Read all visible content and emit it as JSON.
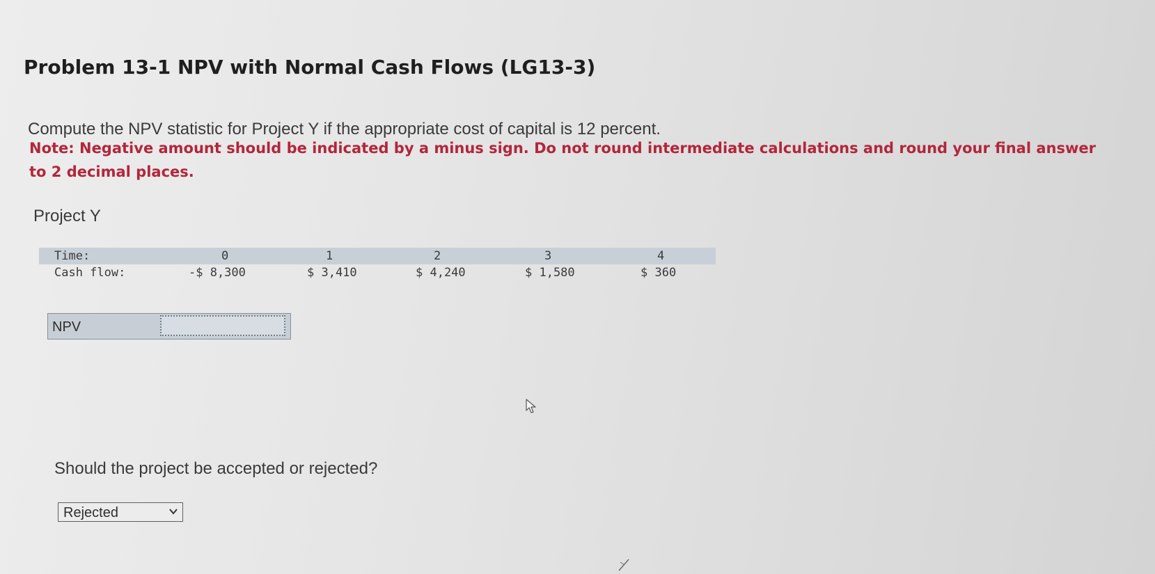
{
  "title": "Problem 13-1 NPV with Normal Cash Flows (LG13-3)",
  "instruction": "Compute the NPV statistic for Project Y if the appropriate cost of capital is 12 percent.",
  "note": "Note: Negative amount should be indicated by a minus sign. Do not round intermediate calculations and round your final answer to 2 decimal places.",
  "project_label": "Project Y",
  "cash_flow_table": {
    "time_label": "Time:",
    "cash_flow_label": "Cash flow:",
    "periods": [
      "0",
      "1",
      "2",
      "3",
      "4"
    ],
    "cash_flows": [
      "-$ 8,300",
      "$ 3,410",
      "$ 4,240",
      "$ 1,580",
      "$ 360"
    ]
  },
  "npv": {
    "label": "NPV",
    "value": ""
  },
  "question": "Should the project be accepted or rejected?",
  "decision_select": {
    "selected": "Rejected"
  },
  "colors": {
    "note": "#b3263b",
    "table_header": "#c9cfd6",
    "npv_box": "#c8ced5"
  },
  "icons": {
    "cursor": "mouse-pointer-icon",
    "dropdown": "chevron-down-icon"
  }
}
